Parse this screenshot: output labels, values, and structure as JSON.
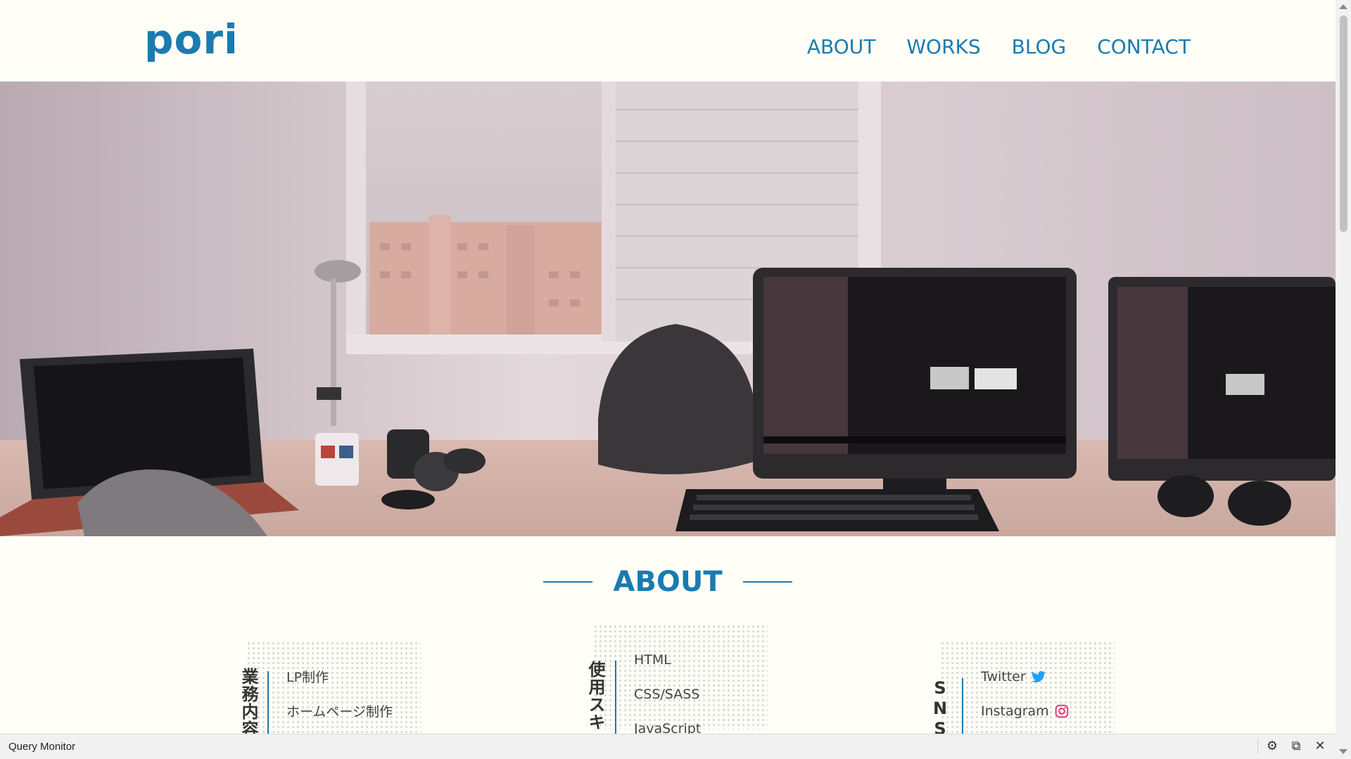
{
  "header": {
    "logo": "pori",
    "nav": [
      "ABOUT",
      "WORKS",
      "BLOG",
      "CONTACT"
    ]
  },
  "about": {
    "title": "ABOUT",
    "cards": [
      {
        "label": "業務内容",
        "items": [
          "LP制作",
          "ホームページ制作"
        ]
      },
      {
        "label": "使用スキ",
        "items": [
          "HTML",
          "CSS/SASS",
          "JavaScript"
        ]
      },
      {
        "label": "SNS",
        "items": [
          "Twitter",
          "Instagram"
        ]
      }
    ]
  },
  "query_monitor": {
    "title": "Query Monitor"
  },
  "colors": {
    "accent": "#1a7bb0",
    "twitter": "#1da1f2",
    "instagram": "#e1306c"
  }
}
